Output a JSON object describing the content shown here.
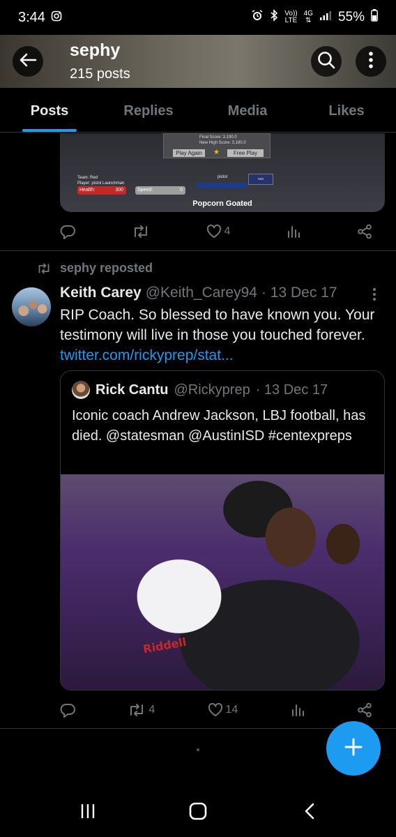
{
  "status_bar": {
    "time": "3:44",
    "volte": "Vo))",
    "lte": "LTE",
    "network": "4G",
    "battery": "55%"
  },
  "header": {
    "title": "sephy",
    "subtitle": "215 posts"
  },
  "tabs": [
    {
      "label": "Posts",
      "active": true
    },
    {
      "label": "Replies",
      "active": false
    },
    {
      "label": "Media",
      "active": false
    },
    {
      "label": "Likes",
      "active": false
    }
  ],
  "post1": {
    "game": {
      "final_score_label": "Final Score: 3,190.0",
      "high_score_label": "New High Score: 3,190.0",
      "play_again": "Play Again",
      "free_play": "Free Play",
      "team": "Team: Red",
      "player": "Player: pistol Launchman",
      "health_label": "Health:",
      "health_value": "300",
      "speed_label": "Speed:",
      "speed_value": "0",
      "weapon": "pistol",
      "slot": "ooo"
    },
    "caption": "Popcorn Goated",
    "likes": "4"
  },
  "repost": {
    "label": "sephy reposted",
    "author": {
      "name": "Keith Carey",
      "handle": "@Keith_Carey94",
      "date": "· 13 Dec 17"
    },
    "text": "RIP Coach. So blessed to have known you. Your testimony will live in those you touched forever. ",
    "link": "twitter.com/rickyprep/stat...",
    "quote": {
      "name": "Rick Cantu",
      "handle": "@Rickyprep",
      "date": "· 13 Dec 17",
      "text": "Iconic coach Andrew Jackson, LBJ football, has died. @statesman @AustinISD #centexpreps",
      "helmet_text": "Riddell"
    },
    "retweets": "4",
    "likes": "14"
  },
  "colors": {
    "accent": "#1d9bf0",
    "muted": "#71767b",
    "text": "#e7e9ea",
    "background": "#000000"
  },
  "icons": [
    "back-arrow-icon",
    "search-icon",
    "more-vertical-icon",
    "reply-icon",
    "retweet-icon",
    "heart-icon",
    "views-icon",
    "share-icon",
    "plus-icon"
  ]
}
